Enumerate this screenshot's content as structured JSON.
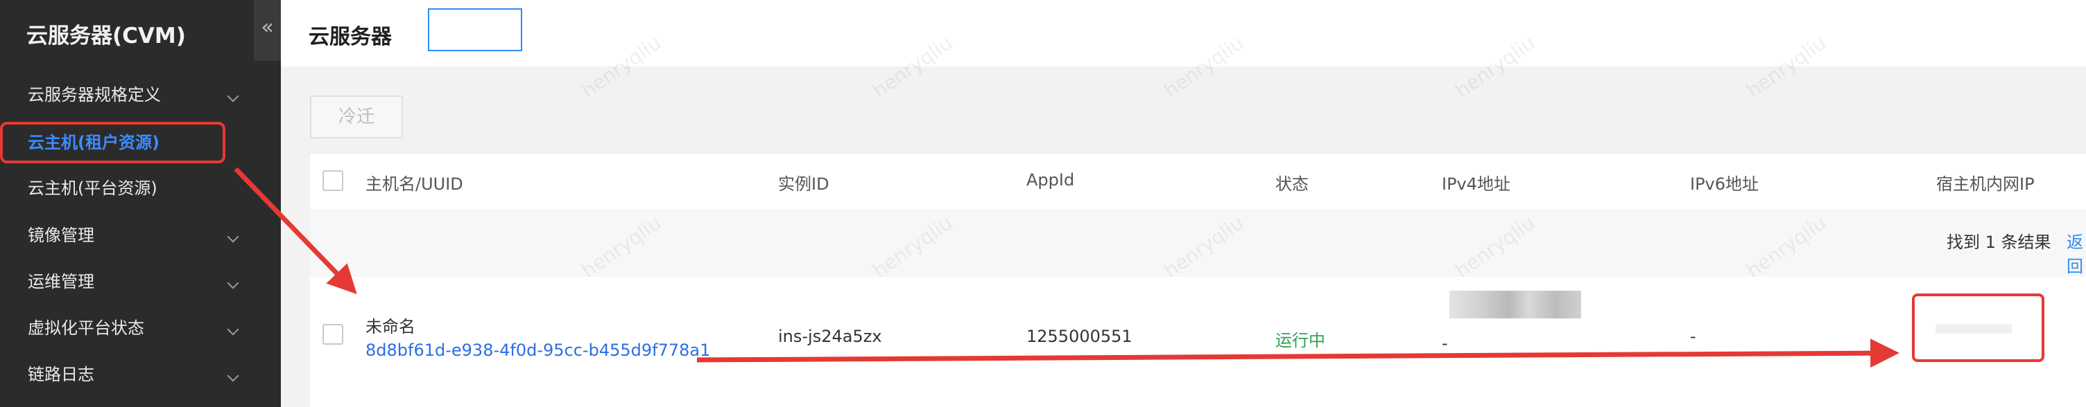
{
  "sidebar": {
    "title": "云服务器(CVM)",
    "collapse_icon": "«",
    "items": [
      {
        "label": "云服务器规格定义",
        "has_chevron": true,
        "active": false
      },
      {
        "label": "云主机(租户资源)",
        "has_chevron": false,
        "active": true
      },
      {
        "label": "云主机(平台资源)",
        "has_chevron": false,
        "active": false
      },
      {
        "label": "镜像管理",
        "has_chevron": true,
        "active": false
      },
      {
        "label": "运维管理",
        "has_chevron": true,
        "active": false
      },
      {
        "label": "虚拟化平台状态",
        "has_chevron": true,
        "active": false
      },
      {
        "label": "链路日志",
        "has_chevron": true,
        "active": false
      }
    ]
  },
  "header": {
    "title": "云服务器",
    "region_value": ""
  },
  "toolbar": {
    "migrate_label": "冷迁"
  },
  "table": {
    "columns": [
      "主机名/UUID",
      "实例ID",
      "AppId",
      "状态",
      "IPv4地址",
      "IPv6地址",
      "宿主机内网IP"
    ],
    "result_text": "找到 1 条结果",
    "result_link": "返回",
    "rows": [
      {
        "name": "未命名",
        "uuid": "8d8bf61d-e938-4f0d-95cc-b455d9f778a1",
        "instance_id": "ins-js24a5zx",
        "appid": "1255000551",
        "status": "运行中",
        "ipv4": "-",
        "ipv6": "-",
        "host_ip": ""
      }
    ]
  },
  "watermark": "henryqliu",
  "colors": {
    "sidebar_bg": "#2b2b2b",
    "accent": "#2d8cf0",
    "annotation": "#e53935",
    "running": "#2ea44f"
  }
}
